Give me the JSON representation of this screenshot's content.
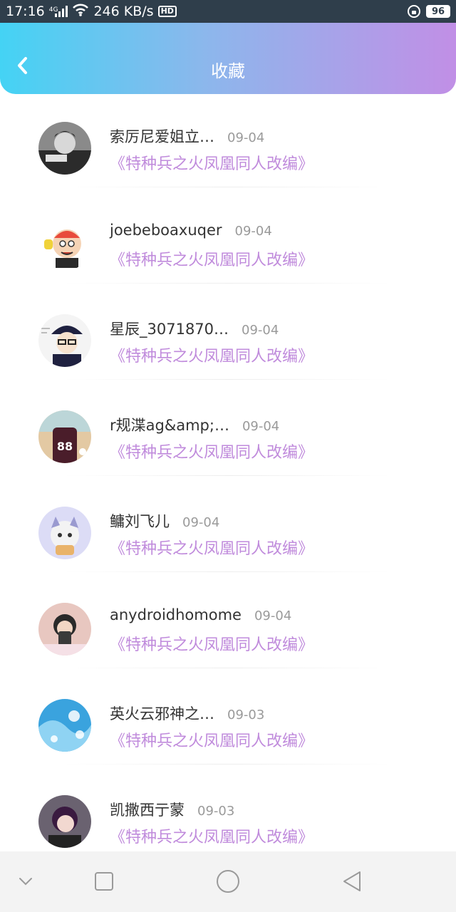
{
  "status_bar": {
    "time": "17:16",
    "network_type": "4G",
    "speed": "246 KB/s",
    "hd_label": "HD",
    "battery": "96"
  },
  "header": {
    "title": "收藏"
  },
  "icons": {
    "back": "chevron-left-icon",
    "nav_back": "triangle-back-icon",
    "nav_home": "circle-home-icon",
    "nav_recent": "square-recent-icon",
    "nav_hide": "chevron-down-icon"
  },
  "colors": {
    "header_gradient": [
      "#44d3f4",
      "#8cb7ec",
      "#c18fe6"
    ],
    "novel_title": "#c08bdc",
    "date": "#9a9a9a",
    "username": "#333333"
  },
  "favorites": [
    {
      "user": "索厉尼爱姐立…",
      "date": "09-04",
      "novel": "《特种兵之火凤凰同人改编》"
    },
    {
      "user": "joebeboaxuqer",
      "date": "09-04",
      "novel": "《特种兵之火凤凰同人改编》"
    },
    {
      "user": "星辰_3071870…",
      "date": "09-04",
      "novel": "《特种兵之火凤凰同人改编》"
    },
    {
      "user": "r规渫ag&amp;…",
      "date": "09-04",
      "novel": "《特种兵之火凤凰同人改编》"
    },
    {
      "user": "鳙刘飞儿",
      "date": "09-04",
      "novel": "《特种兵之火凤凰同人改编》"
    },
    {
      "user": "anydroidhomome",
      "date": "09-04",
      "novel": "《特种兵之火凤凰同人改编》"
    },
    {
      "user": "英火云邪神之…",
      "date": "09-03",
      "novel": "《特种兵之火凤凰同人改编》"
    },
    {
      "user": "凯撒西亍蒙",
      "date": "09-03",
      "novel": "《特种兵之火凤凰同人改编》"
    }
  ]
}
